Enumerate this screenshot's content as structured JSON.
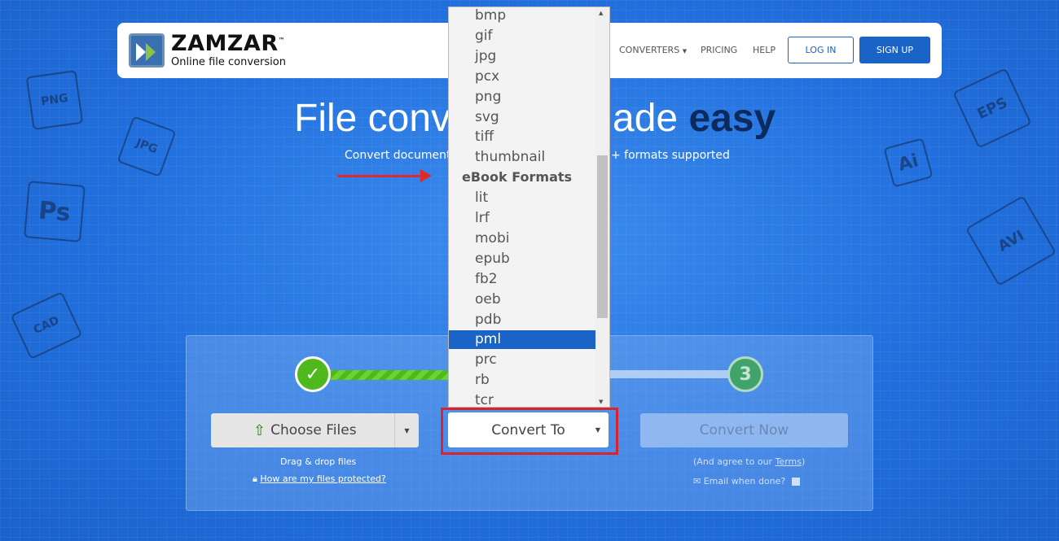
{
  "nav": {
    "brand": "ZAMZAR",
    "trademark": "™",
    "tagline": "Online file conversion",
    "links": [
      "CONVERTERS",
      "PRICING",
      "HELP"
    ],
    "login": "LOG IN",
    "signup": "SIGN UP"
  },
  "hero": {
    "title_left": "File conv",
    "title_right": "ade",
    "title_bold": "easy",
    "subtitle_left": "Convert documents,",
    "subtitle_right": "+ formats supported"
  },
  "dropdown": {
    "items": [
      {
        "label": "bmp"
      },
      {
        "label": "gif"
      },
      {
        "label": "jpg"
      },
      {
        "label": "pcx"
      },
      {
        "label": "png"
      },
      {
        "label": "svg"
      },
      {
        "label": "tiff"
      },
      {
        "label": "thumbnail"
      },
      {
        "label": "eBook Formats",
        "group": true
      },
      {
        "label": "lit"
      },
      {
        "label": "lrf"
      },
      {
        "label": "mobi"
      },
      {
        "label": "epub"
      },
      {
        "label": "fb2"
      },
      {
        "label": "oeb"
      },
      {
        "label": "pdb"
      },
      {
        "label": "pml",
        "selected": true
      },
      {
        "label": "prc"
      },
      {
        "label": "rb"
      },
      {
        "label": "tcr"
      }
    ]
  },
  "steps": {
    "step1": "✓",
    "step3": "3"
  },
  "choose": {
    "label": "Choose Files",
    "hint": "Drag & drop files",
    "protect": "How are my files protected?"
  },
  "convert_to": {
    "label": "Convert To"
  },
  "convert_now": {
    "label": "Convert Now",
    "agree_prefix": "(And agree to our ",
    "terms": "Terms",
    "agree_suffix": ")",
    "email": "Email when done?"
  },
  "decor": [
    "PNG",
    "JPG",
    "Ps",
    "CAD",
    "EPS",
    "Ai",
    "AVI"
  ],
  "colors": {
    "accent": "#1a63c7",
    "highlight": "#d9232e",
    "success": "#4fb81c"
  }
}
